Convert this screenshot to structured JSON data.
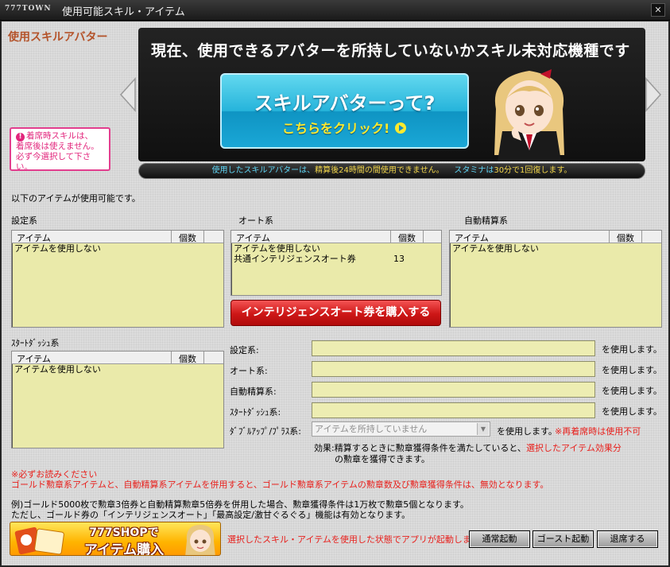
{
  "window": {
    "logo": "777TOWN",
    "title": "使用可能スキル・アイテム",
    "close_glyph": "✕"
  },
  "avatar_section": {
    "heading": "使用スキルアバター",
    "note_lines": [
      "着席時スキルは、",
      "着席後は使えません。",
      "必ず今選択して下さい。"
    ],
    "note_icon": "exclamation-icon",
    "banner_text": "現在、使用できるアバターを所持していないかスキル未対応機種です",
    "skill_button_title": "スキルアバターって?",
    "skill_button_sub": "こちらをクリック!",
    "info_part1": "使用したスキルアバターは、",
    "info_part2": "精算後24時間の間使用できません。",
    "info_part3": "スタミナは",
    "info_part4": "30分で1回復します。"
  },
  "items": {
    "usable_title": "以下のアイテムが使用可能です。",
    "column_item": "アイテム",
    "column_count": "個数",
    "groups": {
      "settei": {
        "label": "設定系",
        "rows": [
          {
            "name": "アイテムを使用しない",
            "count": ""
          }
        ]
      },
      "auto": {
        "label": "オート系",
        "rows": [
          {
            "name": "アイテムを使用しない",
            "count": ""
          },
          {
            "name": "共通インテリジェンスオート券",
            "count": "13"
          }
        ]
      },
      "jido": {
        "label": "自動精算系",
        "rows": [
          {
            "name": "アイテムを使用しない",
            "count": ""
          }
        ]
      },
      "dash": {
        "label": "ｽﾀｰﾄﾀﾞｯｼｭ系",
        "rows": [
          {
            "name": "アイテムを使用しない",
            "count": ""
          }
        ]
      }
    },
    "buy_button": "インテリジェンスオート券を購入する"
  },
  "selection": {
    "fields": [
      {
        "label": "設定系:",
        "value": "",
        "suffix": "を使用します。"
      },
      {
        "label": "オート系:",
        "value": "",
        "suffix": "を使用します。"
      },
      {
        "label": "自動精算系:",
        "value": "",
        "suffix": "を使用します。"
      },
      {
        "label": "ｽﾀｰﾄﾀﾞｯｼｭ系:",
        "value": "",
        "suffix": "を使用します。"
      }
    ],
    "double_label": "ﾀﾞﾌﾞﾙｱｯﾌﾟ/ﾌﾟﾗｽ系:",
    "double_value": "アイテムを所持していません",
    "double_suffix": "を使用します。",
    "double_warning": "※再着席時は使用不可",
    "effect_prefix": "効果:精算するときに勲章獲得条件を満たしていると、",
    "effect_red": "選択したアイテム効果分",
    "effect_line2": "の勲章を獲得できます。"
  },
  "notices": {
    "read_title": "※必ずお読みください",
    "read_body": "ゴールド勲章系アイテムと、自動精算系アイテムを併用すると、ゴールド勲章系アイテムの勲章数及び勲章獲得条件は、無効となります。",
    "example1": "例)ゴールド5000枚で勲章3倍券と自動精算勲章5倍券を併用した場合、勲章獲得条件は1万枚で勲章5個となります。",
    "example2": "ただし、ゴールド券の「インテリジェンスオート」「最高設定/激甘ぐるぐる」機能は有効となります。"
  },
  "footer": {
    "shop_line1": "777SHOPで",
    "shop_line2": "アイテム購入",
    "message": "選択したスキル・アイテムを使用した状態でアプリが起動します。",
    "btn_normal": "通常起動",
    "btn_ghost": "ゴースト起動",
    "btn_leave": "退席する"
  }
}
